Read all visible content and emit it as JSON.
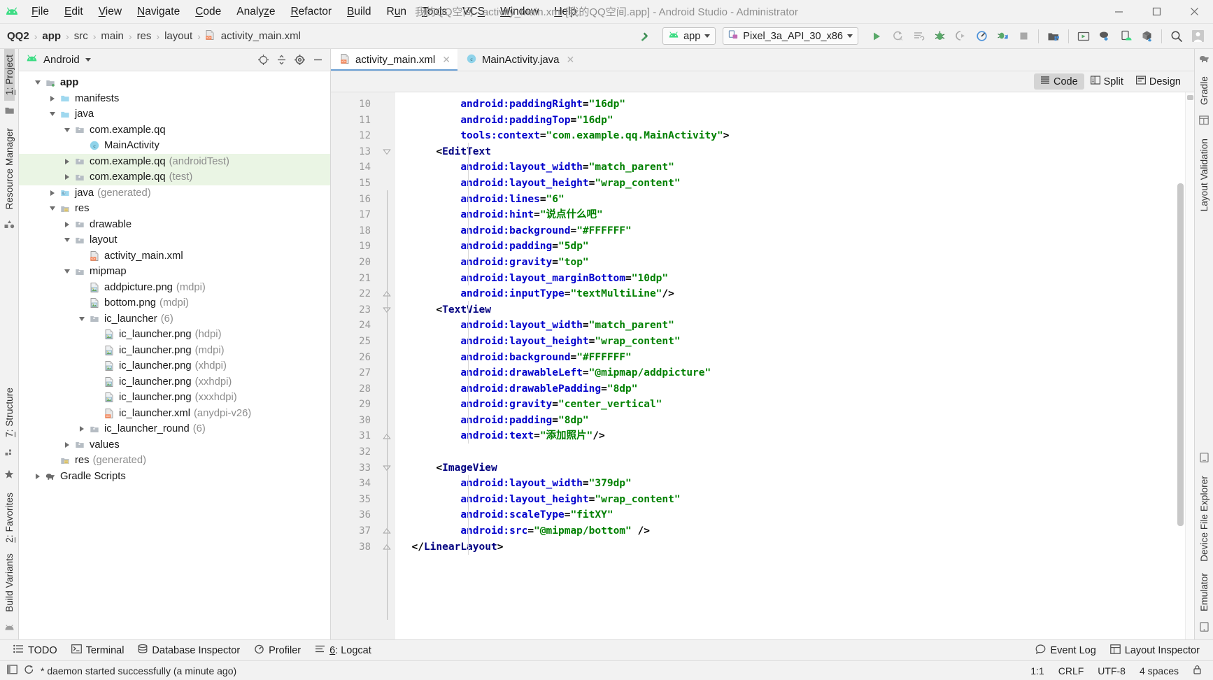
{
  "window": {
    "title": "我的QQ空间 - activity_main.xml [我的QQ空间.app] - Android Studio - Administrator",
    "minimize": "—",
    "maximize": "▢",
    "close": "✕"
  },
  "menubar": {
    "items": [
      {
        "label": "File"
      },
      {
        "label": "Edit"
      },
      {
        "label": "View"
      },
      {
        "label": "Navigate"
      },
      {
        "label": "Code"
      },
      {
        "label": "Analyze"
      },
      {
        "label": "Refactor"
      },
      {
        "label": "Build"
      },
      {
        "label": "Run"
      },
      {
        "label": "Tools"
      },
      {
        "label": "VCS"
      },
      {
        "label": "Window"
      },
      {
        "label": "Help"
      }
    ]
  },
  "toolbar": {
    "breadcrumb": [
      "QQ2",
      "app",
      "src",
      "main",
      "res",
      "layout",
      "activity_main.xml"
    ],
    "run_config": "app",
    "device": "Pixel_3a_API_30_x86",
    "icons": [
      "hammer-icon",
      "run-icon",
      "rerun-icon",
      "run-with-coverage-icon",
      "debug-icon",
      "attach-debugger-icon",
      "profiler-icon",
      "apply-changes-icon",
      "stop-icon",
      "sdk-manager-icon",
      "avd-manager-icon",
      "sync-gradle-icon",
      "layout-inspector-icon",
      "device-manager-icon",
      "search-icon",
      "account-icon"
    ]
  },
  "left_rail": {
    "top": [
      {
        "label": "1: Project",
        "active": true,
        "mnemonic": "1"
      },
      {
        "label": "Resource Manager",
        "active": false
      }
    ],
    "bottom": [
      {
        "label": "7: Structure",
        "active": false,
        "mnemonic": "7"
      },
      {
        "label": "2: Favorites",
        "active": false,
        "mnemonic": "2"
      },
      {
        "label": "Build Variants",
        "active": false
      }
    ]
  },
  "right_rail": {
    "items": [
      {
        "label": "Gradle"
      },
      {
        "label": "Layout Validation"
      },
      {
        "label": "Device File Explorer"
      },
      {
        "label": "Emulator"
      }
    ]
  },
  "project_panel": {
    "title": "Android",
    "tools": [
      "target-icon",
      "collapse-all-icon",
      "settings-gear-icon",
      "hide-icon"
    ],
    "tree": [
      {
        "depth": 0,
        "toggle": "down",
        "icon": "module-folder-icon",
        "label": "app",
        "qualifier": "",
        "bold": true,
        "highlight": false
      },
      {
        "depth": 1,
        "toggle": "right",
        "icon": "folder-icon",
        "label": "manifests",
        "qualifier": "",
        "bold": false,
        "highlight": false
      },
      {
        "depth": 1,
        "toggle": "down",
        "icon": "folder-icon",
        "label": "java",
        "qualifier": "",
        "bold": false,
        "highlight": false
      },
      {
        "depth": 2,
        "toggle": "down",
        "icon": "package-icon",
        "label": "com.example.qq",
        "qualifier": "",
        "bold": false,
        "highlight": false
      },
      {
        "depth": 3,
        "toggle": "none",
        "icon": "java-class-icon",
        "label": "MainActivity",
        "qualifier": "",
        "bold": false,
        "highlight": false
      },
      {
        "depth": 2,
        "toggle": "right",
        "icon": "package-icon",
        "label": "com.example.qq",
        "qualifier": "(androidTest)",
        "bold": false,
        "highlight": true
      },
      {
        "depth": 2,
        "toggle": "right",
        "icon": "package-icon",
        "label": "com.example.qq",
        "qualifier": "(test)",
        "bold": false,
        "highlight": true
      },
      {
        "depth": 1,
        "toggle": "right",
        "icon": "generated-folder-icon",
        "label": "java",
        "qualifier": "(generated)",
        "bold": false,
        "highlight": false
      },
      {
        "depth": 1,
        "toggle": "down",
        "icon": "res-folder-icon",
        "label": "res",
        "qualifier": "",
        "bold": false,
        "highlight": false
      },
      {
        "depth": 2,
        "toggle": "right",
        "icon": "package-icon",
        "label": "drawable",
        "qualifier": "",
        "bold": false,
        "highlight": false
      },
      {
        "depth": 2,
        "toggle": "down",
        "icon": "package-icon",
        "label": "layout",
        "qualifier": "",
        "bold": false,
        "highlight": false
      },
      {
        "depth": 3,
        "toggle": "none",
        "icon": "xml-file-icon",
        "label": "activity_main.xml",
        "qualifier": "",
        "bold": false,
        "highlight": false
      },
      {
        "depth": 2,
        "toggle": "down",
        "icon": "package-icon",
        "label": "mipmap",
        "qualifier": "",
        "bold": false,
        "highlight": false
      },
      {
        "depth": 3,
        "toggle": "none",
        "icon": "png-file-icon",
        "label": "addpicture.png",
        "qualifier": "(mdpi)",
        "bold": false,
        "highlight": false
      },
      {
        "depth": 3,
        "toggle": "none",
        "icon": "png-file-icon",
        "label": "bottom.png",
        "qualifier": "(mdpi)",
        "bold": false,
        "highlight": false
      },
      {
        "depth": 3,
        "toggle": "down",
        "icon": "package-icon",
        "label": "ic_launcher",
        "qualifier": "(6)",
        "bold": false,
        "highlight": false
      },
      {
        "depth": 4,
        "toggle": "none",
        "icon": "png-file-icon",
        "label": "ic_launcher.png",
        "qualifier": "(hdpi)",
        "bold": false,
        "highlight": false
      },
      {
        "depth": 4,
        "toggle": "none",
        "icon": "png-file-icon",
        "label": "ic_launcher.png",
        "qualifier": "(mdpi)",
        "bold": false,
        "highlight": false
      },
      {
        "depth": 4,
        "toggle": "none",
        "icon": "png-file-icon",
        "label": "ic_launcher.png",
        "qualifier": "(xhdpi)",
        "bold": false,
        "highlight": false
      },
      {
        "depth": 4,
        "toggle": "none",
        "icon": "png-file-icon",
        "label": "ic_launcher.png",
        "qualifier": "(xxhdpi)",
        "bold": false,
        "highlight": false
      },
      {
        "depth": 4,
        "toggle": "none",
        "icon": "png-file-icon",
        "label": "ic_launcher.png",
        "qualifier": "(xxxhdpi)",
        "bold": false,
        "highlight": false
      },
      {
        "depth": 4,
        "toggle": "none",
        "icon": "xml-file-icon",
        "label": "ic_launcher.xml",
        "qualifier": "(anydpi-v26)",
        "bold": false,
        "highlight": false
      },
      {
        "depth": 3,
        "toggle": "right",
        "icon": "package-icon",
        "label": "ic_launcher_round",
        "qualifier": "(6)",
        "bold": false,
        "highlight": false
      },
      {
        "depth": 2,
        "toggle": "right",
        "icon": "package-icon",
        "label": "values",
        "qualifier": "",
        "bold": false,
        "highlight": false
      },
      {
        "depth": 1,
        "toggle": "none",
        "icon": "res-folder-icon",
        "label": "res",
        "qualifier": "(generated)",
        "bold": false,
        "highlight": false
      },
      {
        "depth": 0,
        "toggle": "right",
        "icon": "gradle-icon",
        "label": "Gradle Scripts",
        "qualifier": "",
        "bold": false,
        "highlight": false
      }
    ]
  },
  "editor": {
    "tabs": [
      {
        "label": "activity_main.xml",
        "icon": "xml-file-icon",
        "active": true,
        "close": "✕"
      },
      {
        "label": "MainActivity.java",
        "icon": "java-class-icon",
        "active": false,
        "close": "✕"
      }
    ],
    "modes": [
      {
        "label": "Code",
        "icon": "code-view-icon",
        "active": true
      },
      {
        "label": "Split",
        "icon": "split-view-icon",
        "active": false
      },
      {
        "label": "Design",
        "icon": "design-view-icon",
        "active": false
      }
    ],
    "first_line_number": 10,
    "lines": [
      {
        "n": 10,
        "fold": "none",
        "indent": 2,
        "tokens": [
          {
            "t": "a",
            "v": "android:paddingRight"
          },
          {
            "t": "p",
            "v": "="
          },
          {
            "t": "s",
            "v": "\"16dp\""
          }
        ]
      },
      {
        "n": 11,
        "fold": "none",
        "indent": 2,
        "tokens": [
          {
            "t": "a",
            "v": "android:paddingTop"
          },
          {
            "t": "p",
            "v": "="
          },
          {
            "t": "s",
            "v": "\"16dp\""
          }
        ]
      },
      {
        "n": 12,
        "fold": "none",
        "indent": 2,
        "tokens": [
          {
            "t": "a",
            "v": "tools:context"
          },
          {
            "t": "p",
            "v": "="
          },
          {
            "t": "s",
            "v": "\"com.example.qq.MainActivity\""
          },
          {
            "t": "p",
            "v": ">"
          }
        ]
      },
      {
        "n": 13,
        "fold": "tri",
        "indent": 1,
        "tokens": [
          {
            "t": "p",
            "v": "<"
          },
          {
            "t": "k",
            "v": "EditText"
          }
        ]
      },
      {
        "n": 14,
        "fold": "none",
        "indent": 2,
        "tokens": [
          {
            "t": "a",
            "v": "android:layout_width"
          },
          {
            "t": "p",
            "v": "="
          },
          {
            "t": "s",
            "v": "\"match_parent\""
          }
        ]
      },
      {
        "n": 15,
        "fold": "none",
        "indent": 2,
        "tokens": [
          {
            "t": "a",
            "v": "android:layout_height"
          },
          {
            "t": "p",
            "v": "="
          },
          {
            "t": "s",
            "v": "\"wrap_content\""
          }
        ]
      },
      {
        "n": 16,
        "fold": "none",
        "indent": 2,
        "tokens": [
          {
            "t": "a",
            "v": "android:lines"
          },
          {
            "t": "p",
            "v": "="
          },
          {
            "t": "s",
            "v": "\"6\""
          }
        ]
      },
      {
        "n": 17,
        "fold": "none",
        "indent": 2,
        "tokens": [
          {
            "t": "a",
            "v": "android:hint"
          },
          {
            "t": "p",
            "v": "="
          },
          {
            "t": "s",
            "v": "\"说点什么吧\""
          }
        ]
      },
      {
        "n": 18,
        "fold": "none",
        "indent": 2,
        "tokens": [
          {
            "t": "a",
            "v": "android:background"
          },
          {
            "t": "p",
            "v": "="
          },
          {
            "t": "s",
            "v": "\"#FFFFFF\""
          }
        ]
      },
      {
        "n": 19,
        "fold": "none",
        "indent": 2,
        "tokens": [
          {
            "t": "a",
            "v": "android:padding"
          },
          {
            "t": "p",
            "v": "="
          },
          {
            "t": "s",
            "v": "\"5dp\""
          }
        ]
      },
      {
        "n": 20,
        "fold": "none",
        "indent": 2,
        "tokens": [
          {
            "t": "a",
            "v": "android:gravity"
          },
          {
            "t": "p",
            "v": "="
          },
          {
            "t": "s",
            "v": "\"top\""
          }
        ]
      },
      {
        "n": 21,
        "fold": "none",
        "indent": 2,
        "tokens": [
          {
            "t": "a",
            "v": "android:layout_marginBottom"
          },
          {
            "t": "p",
            "v": "="
          },
          {
            "t": "s",
            "v": "\"10dp\""
          }
        ]
      },
      {
        "n": 22,
        "fold": "end",
        "indent": 2,
        "tokens": [
          {
            "t": "a",
            "v": "android:inputType"
          },
          {
            "t": "p",
            "v": "="
          },
          {
            "t": "s",
            "v": "\"textMultiLine\""
          },
          {
            "t": "p",
            "v": "/>"
          }
        ]
      },
      {
        "n": 23,
        "fold": "tri",
        "indent": 1,
        "tokens": [
          {
            "t": "p",
            "v": "<"
          },
          {
            "t": "k",
            "v": "TextView"
          }
        ]
      },
      {
        "n": 24,
        "fold": "none",
        "indent": 2,
        "tokens": [
          {
            "t": "a",
            "v": "android:layout_width"
          },
          {
            "t": "p",
            "v": "="
          },
          {
            "t": "s",
            "v": "\"match_parent\""
          }
        ]
      },
      {
        "n": 25,
        "fold": "none",
        "indent": 2,
        "tokens": [
          {
            "t": "a",
            "v": "android:layout_height"
          },
          {
            "t": "p",
            "v": "="
          },
          {
            "t": "s",
            "v": "\"wrap_content\""
          }
        ]
      },
      {
        "n": 26,
        "fold": "none",
        "indent": 2,
        "tokens": [
          {
            "t": "a",
            "v": "android:background"
          },
          {
            "t": "p",
            "v": "="
          },
          {
            "t": "s",
            "v": "\"#FFFFFF\""
          }
        ]
      },
      {
        "n": 27,
        "fold": "none",
        "indent": 2,
        "tokens": [
          {
            "t": "a",
            "v": "android:drawableLeft"
          },
          {
            "t": "p",
            "v": "="
          },
          {
            "t": "s",
            "v": "\"@mipmap/addpicture\""
          }
        ]
      },
      {
        "n": 28,
        "fold": "none",
        "indent": 2,
        "tokens": [
          {
            "t": "a",
            "v": "android:drawablePadding"
          },
          {
            "t": "p",
            "v": "="
          },
          {
            "t": "s",
            "v": "\"8dp\""
          }
        ]
      },
      {
        "n": 29,
        "fold": "none",
        "indent": 2,
        "tokens": [
          {
            "t": "a",
            "v": "android:gravity"
          },
          {
            "t": "p",
            "v": "="
          },
          {
            "t": "s",
            "v": "\"center_vertical\""
          }
        ]
      },
      {
        "n": 30,
        "fold": "none",
        "indent": 2,
        "tokens": [
          {
            "t": "a",
            "v": "android:padding"
          },
          {
            "t": "p",
            "v": "="
          },
          {
            "t": "s",
            "v": "\"8dp\""
          }
        ]
      },
      {
        "n": 31,
        "fold": "end",
        "indent": 2,
        "tokens": [
          {
            "t": "a",
            "v": "android:text"
          },
          {
            "t": "p",
            "v": "="
          },
          {
            "t": "s",
            "v": "\"添加照片\""
          },
          {
            "t": "p",
            "v": "/>"
          }
        ]
      },
      {
        "n": 32,
        "fold": "none",
        "indent": 0,
        "tokens": []
      },
      {
        "n": 33,
        "fold": "tri",
        "indent": 1,
        "tokens": [
          {
            "t": "p",
            "v": "<"
          },
          {
            "t": "k",
            "v": "ImageView"
          }
        ]
      },
      {
        "n": 34,
        "fold": "none",
        "indent": 2,
        "tokens": [
          {
            "t": "a",
            "v": "android:layout_width"
          },
          {
            "t": "p",
            "v": "="
          },
          {
            "t": "s",
            "v": "\"379dp\""
          }
        ]
      },
      {
        "n": 35,
        "fold": "none",
        "indent": 2,
        "tokens": [
          {
            "t": "a",
            "v": "android:layout_height"
          },
          {
            "t": "p",
            "v": "="
          },
          {
            "t": "s",
            "v": "\"wrap_content\""
          }
        ]
      },
      {
        "n": 36,
        "fold": "none",
        "indent": 2,
        "tokens": [
          {
            "t": "a",
            "v": "android:scaleType"
          },
          {
            "t": "p",
            "v": "="
          },
          {
            "t": "s",
            "v": "\"fitXY\""
          }
        ]
      },
      {
        "n": 37,
        "fold": "end",
        "indent": 2,
        "tokens": [
          {
            "t": "a",
            "v": "android:src"
          },
          {
            "t": "p",
            "v": "="
          },
          {
            "t": "s",
            "v": "\"@mipmap/bottom\""
          },
          {
            "t": "p",
            "v": " />"
          }
        ]
      },
      {
        "n": 38,
        "fold": "end",
        "indent": 0,
        "tokens": [
          {
            "t": "p",
            "v": "</"
          },
          {
            "t": "k",
            "v": "LinearLayout"
          },
          {
            "t": "p",
            "v": ">"
          }
        ]
      }
    ]
  },
  "bottom_toolwindows": {
    "left": [
      {
        "label": "TODO",
        "icon": "todo-icon"
      },
      {
        "label": "Terminal",
        "icon": "terminal-icon"
      },
      {
        "label": "Database Inspector",
        "icon": "database-icon"
      },
      {
        "label": "Profiler",
        "icon": "profiler-icon"
      },
      {
        "label": "6: Logcat",
        "icon": "logcat-icon",
        "mnemonic": "6"
      }
    ],
    "right": [
      {
        "label": "Event Log",
        "icon": "event-log-icon"
      },
      {
        "label": "Layout Inspector",
        "icon": "layout-inspector-icon"
      }
    ]
  },
  "status_bar": {
    "message": "* daemon started successfully (a minute ago)",
    "caret": "1:1",
    "line_separator": "CRLF",
    "encoding": "UTF-8",
    "indent": "4 spaces",
    "left_icons": [
      "show-toolwindows-icon",
      "background-tasks-icon"
    ]
  }
}
